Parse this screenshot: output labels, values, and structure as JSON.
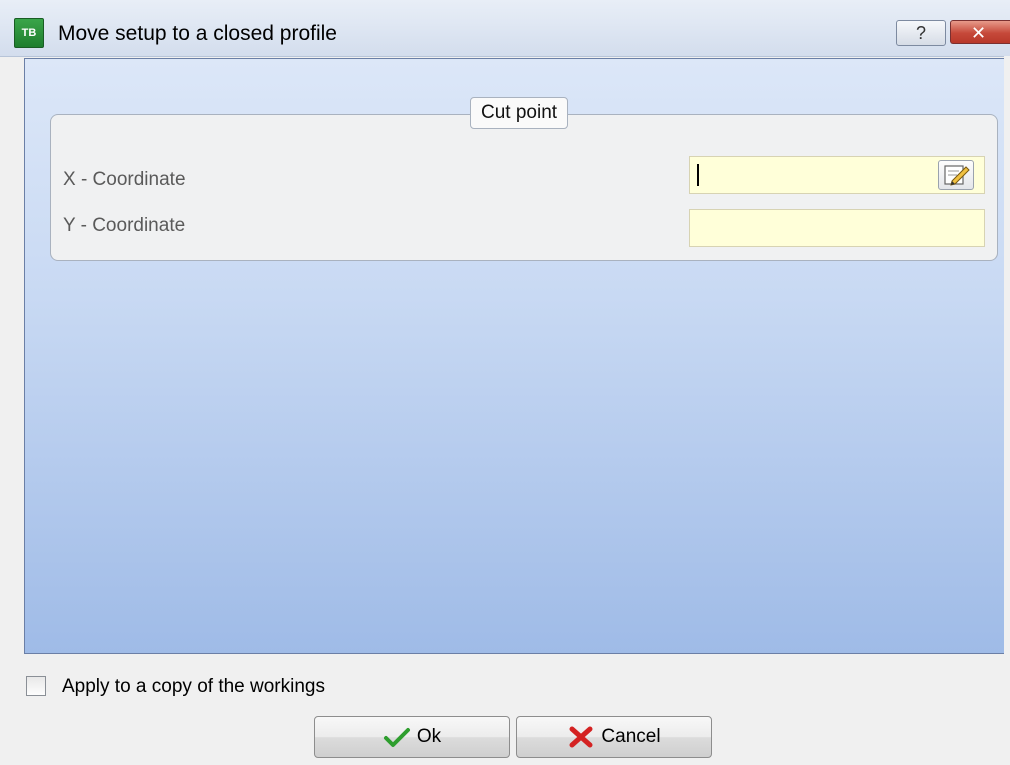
{
  "window": {
    "title": "Move setup to a closed profile",
    "app_icon_text": "TB",
    "help_label": "?",
    "close_label": "✕"
  },
  "group": {
    "title": "Cut point",
    "fields": [
      {
        "label": "X - Coordinate",
        "value": "",
        "placeholder": ""
      },
      {
        "label": "Y - Coordinate",
        "value": "",
        "placeholder": ""
      }
    ]
  },
  "options": {
    "copy_label": "Apply to a copy of the workings",
    "copy_checked": false
  },
  "buttons": {
    "ok_label": "Ok",
    "cancel_label": "Cancel"
  },
  "icons": {
    "app": "app-logo-icon",
    "edit": "edit-pencil-icon",
    "ok": "green-check-icon",
    "cancel": "red-x-icon"
  },
  "colors": {
    "panel_top": "#dce7f8",
    "panel_bottom": "#9fbbe7",
    "input_bg": "#ffffd9",
    "ok_icon": "#2e9e2e",
    "cancel_icon": "#d42222"
  }
}
